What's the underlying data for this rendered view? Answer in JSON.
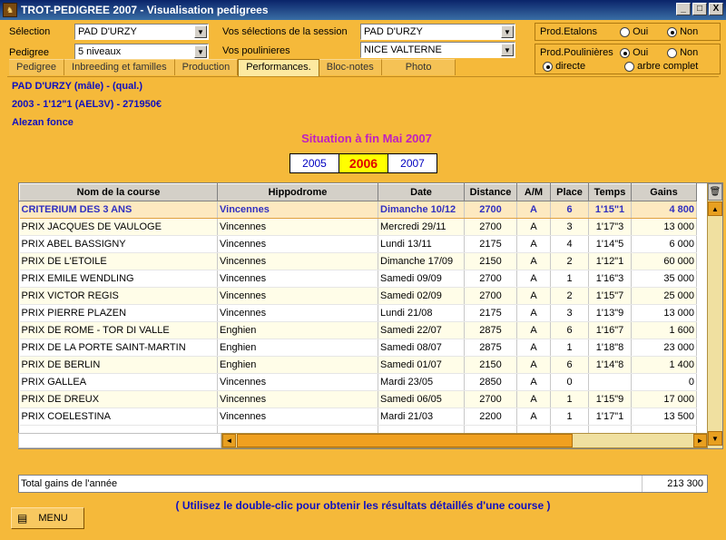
{
  "window": {
    "title": "TROT-PEDIGREE 2007  -  Visualisation pedigrees",
    "min": "_",
    "max": "□",
    "close": "X"
  },
  "selection": {
    "label": "Sélection",
    "value": "PAD D'URZY"
  },
  "pedigree": {
    "label": "Pedigree",
    "value": "5 niveaux"
  },
  "session": {
    "label": "Vos sélections de la session",
    "value": "PAD D'URZY"
  },
  "poulinieres": {
    "label": "Vos poulinieres",
    "value": "NICE VALTERNE"
  },
  "prod_etalons": {
    "label": "Prod.Etalons",
    "oui": "Oui",
    "non": "Non",
    "selected": "Non"
  },
  "prod_poulinieres": {
    "label": "Prod.Poulinières",
    "oui": "Oui",
    "non": "Non",
    "directe": "directe",
    "arbre": "arbre complet",
    "selected": "Oui",
    "mode": "directe"
  },
  "tabs": [
    "Pedigree",
    "Inbreeding et familles",
    "Production",
    "Performances.",
    "Bloc-notes",
    "Photo"
  ],
  "active_tab": "Performances.",
  "horse": {
    "line1": "PAD D'URZY  (mâle) - (qual.)",
    "line2": "2003 -  1'12\"1 (AEL3V) - 271950€",
    "line3": "Alezan fonce"
  },
  "situation": "Situation à fin Mai 2007",
  "years": [
    "2005",
    "2006",
    "2007"
  ],
  "active_year": "2006",
  "table": {
    "headers": [
      "Nom de la course",
      "Hippodrome",
      "Date",
      "Distance",
      "A/M",
      "Place",
      "Temps",
      "Gains"
    ],
    "rows": [
      [
        "CRITERIUM DES 3 ANS",
        "Vincennes",
        "Dimanche 10/12",
        "2700",
        "A",
        "6",
        "1'15\"1",
        "4 800"
      ],
      [
        "PRIX JACQUES DE VAULOGE",
        "Vincennes",
        "Mercredi 29/11",
        "2700",
        "A",
        "3",
        "1'17\"3",
        "13 000"
      ],
      [
        "PRIX ABEL BASSIGNY",
        "Vincennes",
        "Lundi 13/11",
        "2175",
        "A",
        "4",
        "1'14\"5",
        "6 000"
      ],
      [
        "PRIX DE L'ETOILE",
        "Vincennes",
        "Dimanche 17/09",
        "2150",
        "A",
        "2",
        "1'12\"1",
        "60 000"
      ],
      [
        "PRIX EMILE WENDLING",
        "Vincennes",
        "Samedi 09/09",
        "2700",
        "A",
        "1",
        "1'16\"3",
        "35 000"
      ],
      [
        "PRIX VICTOR REGIS",
        "Vincennes",
        "Samedi 02/09",
        "2700",
        "A",
        "2",
        "1'15\"7",
        "25 000"
      ],
      [
        "PRIX PIERRE PLAZEN",
        "Vincennes",
        "Lundi 21/08",
        "2175",
        "A",
        "3",
        "1'13\"9",
        "13 000"
      ],
      [
        "PRIX DE ROME - TOR DI VALLE",
        "Enghien",
        "Samedi 22/07",
        "2875",
        "A",
        "6",
        "1'16\"7",
        "1 600"
      ],
      [
        "PRIX DE LA PORTE SAINT-MARTIN",
        "Enghien",
        "Samedi 08/07",
        "2875",
        "A",
        "1",
        "1'18\"8",
        "23 000"
      ],
      [
        "PRIX DE BERLIN",
        "Enghien",
        "Samedi 01/07",
        "2150",
        "A",
        "6",
        "1'14\"8",
        "1 400"
      ],
      [
        "PRIX GALLEA",
        "Vincennes",
        "Mardi 23/05",
        "2850",
        "A",
        "0",
        "",
        "0"
      ],
      [
        "PRIX DE DREUX",
        "Vincennes",
        "Samedi 06/05",
        "2700",
        "A",
        "1",
        "1'15\"9",
        "17 000"
      ],
      [
        "PRIX COELESTINA",
        "Vincennes",
        "Mardi 21/03",
        "2200",
        "A",
        "1",
        "1'17\"1",
        "13 500"
      ]
    ],
    "empty_rows": 3
  },
  "total": {
    "label": "Total gains de l'année",
    "value": "213 300"
  },
  "hint": "( Utilisez le double-clic pour obtenir les résultats détaillés d'une course )",
  "menu_label": "MENU",
  "colors": {
    "background": "#f5b93a",
    "title_bar": "#0a246a",
    "highlight_text": "#1010c0",
    "heading": "#c020c0",
    "active_year": "#ffff00"
  },
  "icons": {
    "app": "horse-head-icon",
    "table_corner": "trash-icon",
    "menu": "menu-icon"
  }
}
